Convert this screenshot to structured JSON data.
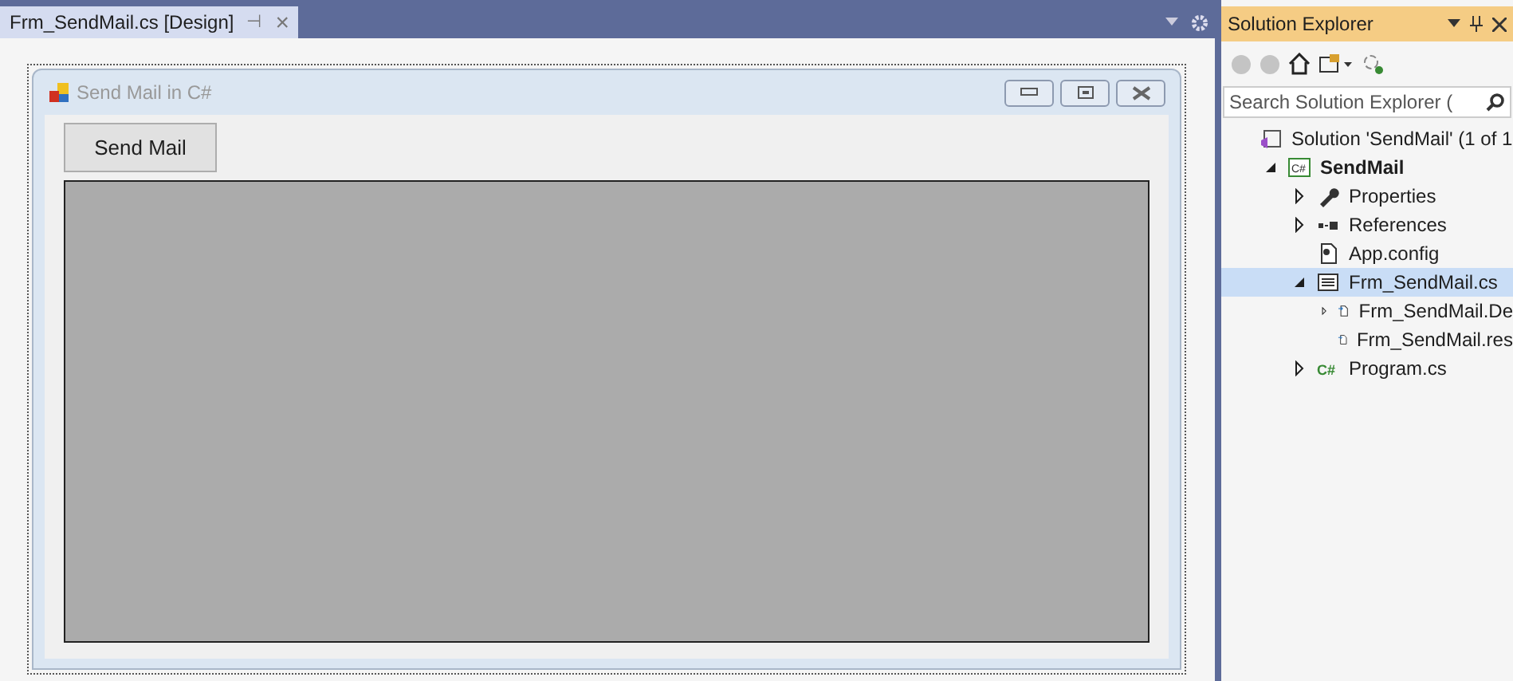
{
  "document_tab": {
    "title": "Frm_SendMail.cs [Design]",
    "pin": "⊣",
    "close": "×"
  },
  "form": {
    "title": "Send Mail in C#",
    "button": "Send Mail"
  },
  "solution_explorer": {
    "title": "Solution Explorer",
    "search": {
      "placeholder": "Search Solution Explorer ("
    },
    "tree": [
      {
        "label": "Solution 'SendMail' (1 of 1",
        "kind": "solution",
        "bold": false,
        "selected": false,
        "children": [
          {
            "label": "SendMail",
            "kind": "csproject",
            "icon_text": "C#",
            "expanded": true,
            "bold": true,
            "selected": false,
            "children": [
              {
                "label": "Properties",
                "kind": "wrench",
                "expanded": false,
                "bold": false,
                "selected": false
              },
              {
                "label": "References",
                "kind": "references",
                "expanded": false,
                "bold": false,
                "selected": false
              },
              {
                "label": "App.config",
                "kind": "config",
                "bold": false,
                "selected": false
              },
              {
                "label": "Frm_SendMail.cs",
                "kind": "form",
                "expanded": true,
                "bold": false,
                "selected": true,
                "children": [
                  {
                    "label": "Frm_SendMail.De",
                    "kind": "file",
                    "expanded": false,
                    "bold": false,
                    "selected": false
                  },
                  {
                    "label": "Frm_SendMail.res",
                    "kind": "file",
                    "bold": false,
                    "selected": false
                  }
                ]
              },
              {
                "label": "Program.cs",
                "kind": "csharp",
                "icon_text": "C#",
                "expanded": false,
                "bold": false,
                "selected": false
              }
            ]
          }
        ]
      }
    ]
  }
}
